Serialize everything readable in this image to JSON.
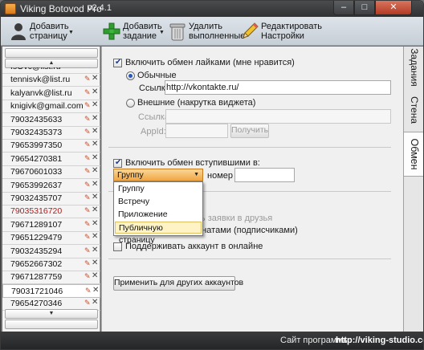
{
  "window": {
    "title": "Viking Botovod Pro",
    "version": "v2.4.1",
    "minimize_glyph": "–",
    "maximize_glyph": "□",
    "close_glyph": "✕"
  },
  "toolbar": {
    "add_account": "Добавить\nстраницу",
    "add_task": "Добавить\nзадание",
    "delete_done": "Удалить\nвыполненные",
    "edit_settings": "Редактировать\nНастройки",
    "caret": "▼"
  },
  "accounts": {
    "scroll_up": "▲",
    "scroll_down": "▼",
    "edit_glyph": "✎",
    "delete_glyph": "✕",
    "items": [
      {
        "name": "fsOvc@list.ru",
        "partial": true
      },
      {
        "name": "tennisvk@list.ru"
      },
      {
        "name": "kalyanvk@list.ru"
      },
      {
        "name": "knigivk@gmail.com"
      },
      {
        "name": "79032435633"
      },
      {
        "name": "79032435373"
      },
      {
        "name": "79653997350"
      },
      {
        "name": "79654270381"
      },
      {
        "name": "79670601033"
      },
      {
        "name": "79653992637"
      },
      {
        "name": "79032435707"
      },
      {
        "name": "79035316720",
        "red": true
      },
      {
        "name": "79671289107"
      },
      {
        "name": "79651229479"
      },
      {
        "name": "79032435294"
      },
      {
        "name": "79652667302"
      },
      {
        "name": "79671287759"
      },
      {
        "name": "79031721046",
        "selected": true
      },
      {
        "name": "79654270346"
      }
    ]
  },
  "likes": {
    "enable_label": "Включить обмен лайками (мне нравится)",
    "enabled": true,
    "regular_label": "Обычные",
    "regular_checked": true,
    "link_label": "Ссылка:",
    "link_value": "http://vkontakte.ru/",
    "external_label": "Внешние (накрутка виджета)",
    "external_checked": false,
    "ext_link_label": "Ссылка:",
    "appid_label": "AppId:",
    "get_button": "Получить"
  },
  "joins": {
    "enable_label": "Включить обмен вступившими в:",
    "enabled": true,
    "selected": "Группу",
    "options": [
      "Группу",
      "Встречу",
      "Приложение",
      "Публичную страницу"
    ],
    "highlighted_index": 3,
    "number_label": "номер",
    "number_value": ""
  },
  "other": {
    "friends_label_partial": "ми",
    "requests_label_partial": "ать заявки в друзья",
    "fans_label_partial": "ключить обмен фанатами (подписчиками)",
    "keep_online_label": "Поддерживать аккаунт в онлайне",
    "apply_button": "Применить для других аккаунтов"
  },
  "tabs": [
    "Задания",
    "Стена",
    "Обмен"
  ],
  "active_tab": "Обмен",
  "status": {
    "label": "Сайт программы:",
    "url": "http://viking-studio.com"
  },
  "colors": {
    "combo_highlight": "#f0a540",
    "red_account": "#b31b1b",
    "dropdown_highlight": "#fdf3c5"
  }
}
